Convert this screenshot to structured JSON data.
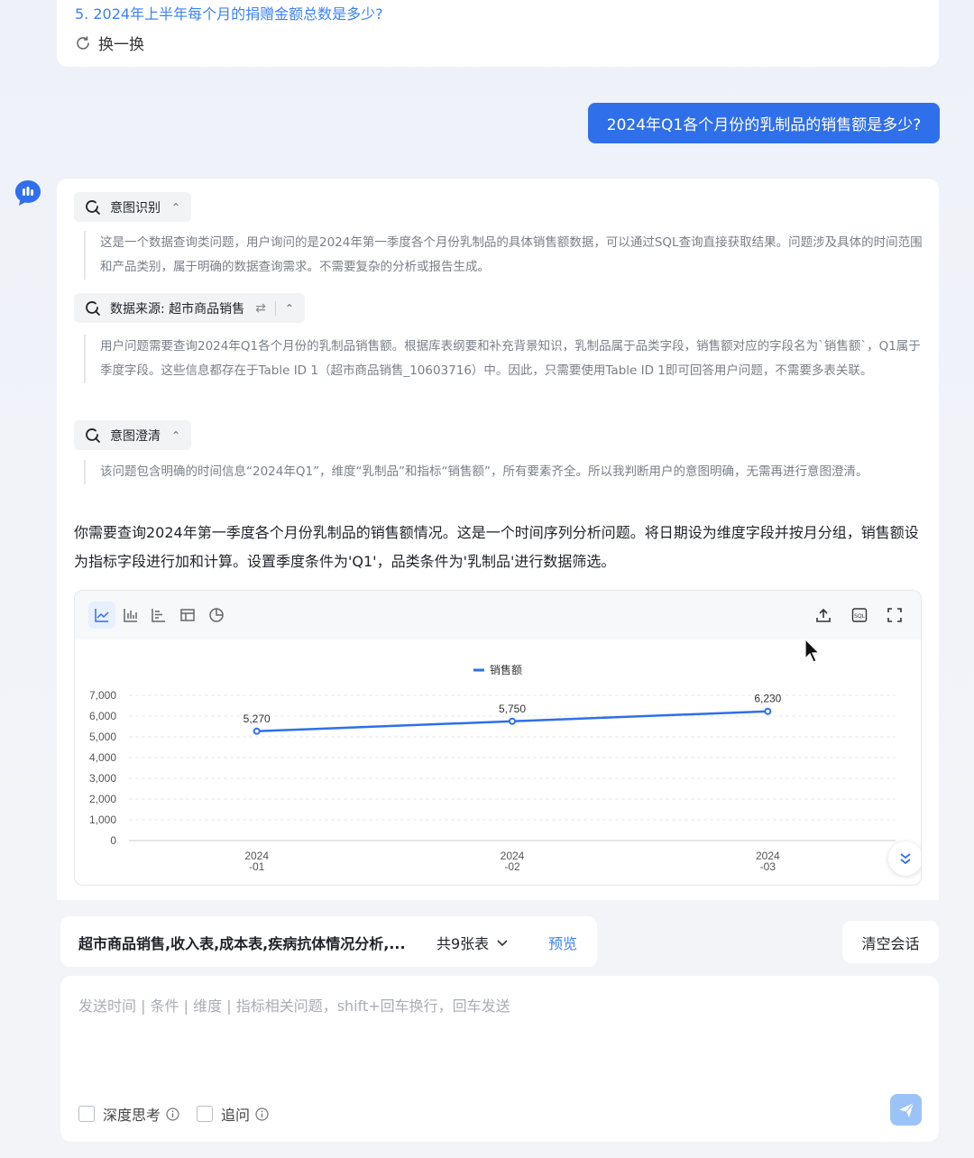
{
  "top_card": {
    "question": "5. 2024年上半年每个月的捐赠金额总数是多少?",
    "refresh_label": "换一换"
  },
  "user_message": "2024年Q1各个月份的乳制品的销售额是多少?",
  "answer": {
    "steps": [
      {
        "title": "意图识别",
        "text": "这是一个数据查询类问题，用户询问的是2024年第一季度各个月份乳制品的具体销售额数据，可以通过SQL查询直接获取结果。问题涉及具体的时间范围和产品类别，属于明确的数据查询需求。不需要复杂的分析或报告生成。"
      },
      {
        "title": "数据来源: 超市商品销售",
        "text": "用户问题需要查询2024年Q1各个月份的乳制品销售额。根据库表纲要和补充背景知识，乳制品属于品类字段，销售额对应的字段名为`销售额`，Q1属于季度字段。这些信息都存在于Table ID 1（超市商品销售_10603716）中。因此，只需要使用Table ID 1即可回答用户问题，不需要多表关联。"
      },
      {
        "title": "意图澄清",
        "text": "该问题包含明确的时间信息“2024年Q1”，维度“乳制品”和指标“销售额”，所有要素齐全。所以我判断用户的意图明确，无需再进行意图澄清。"
      }
    ],
    "summary": "你需要查询2024年第一季度各个月份乳制品的销售额情况。这是一个时间序列分析问题。将日期设为维度字段并按月分组，销售额设为指标字段进行加和计算。设置季度条件为'Q1'，品类条件为'乳制品'进行数据筛选。"
  },
  "chart_data": {
    "type": "line",
    "categories": [
      "2024\n-01",
      "2024\n-02",
      "2024\n-03"
    ],
    "series": [
      {
        "name": "销售额",
        "values": [
          5270,
          5750,
          6230
        ],
        "labels": [
          "5,270",
          "5,750",
          "6,230"
        ]
      }
    ],
    "yticks": [
      "0",
      "1,000",
      "2,000",
      "3,000",
      "4,000",
      "5,000",
      "6,000",
      "7,000"
    ],
    "ylim": [
      0,
      7000
    ],
    "legend_position": "top-center",
    "grid": true,
    "color": "#2f6fe9"
  },
  "source_bar": {
    "tables": "超市商品销售,收入表,成本表,疾病抗体情况分析,...",
    "count": "共9张表",
    "preview": "预览"
  },
  "clear_label": "清空会话",
  "input": {
    "placeholder": "发送时间 | 条件 | 维度 | 指标相关问题，shift+回车换行，回车发送",
    "deep_think": "深度思考",
    "follow_up": "追问"
  }
}
